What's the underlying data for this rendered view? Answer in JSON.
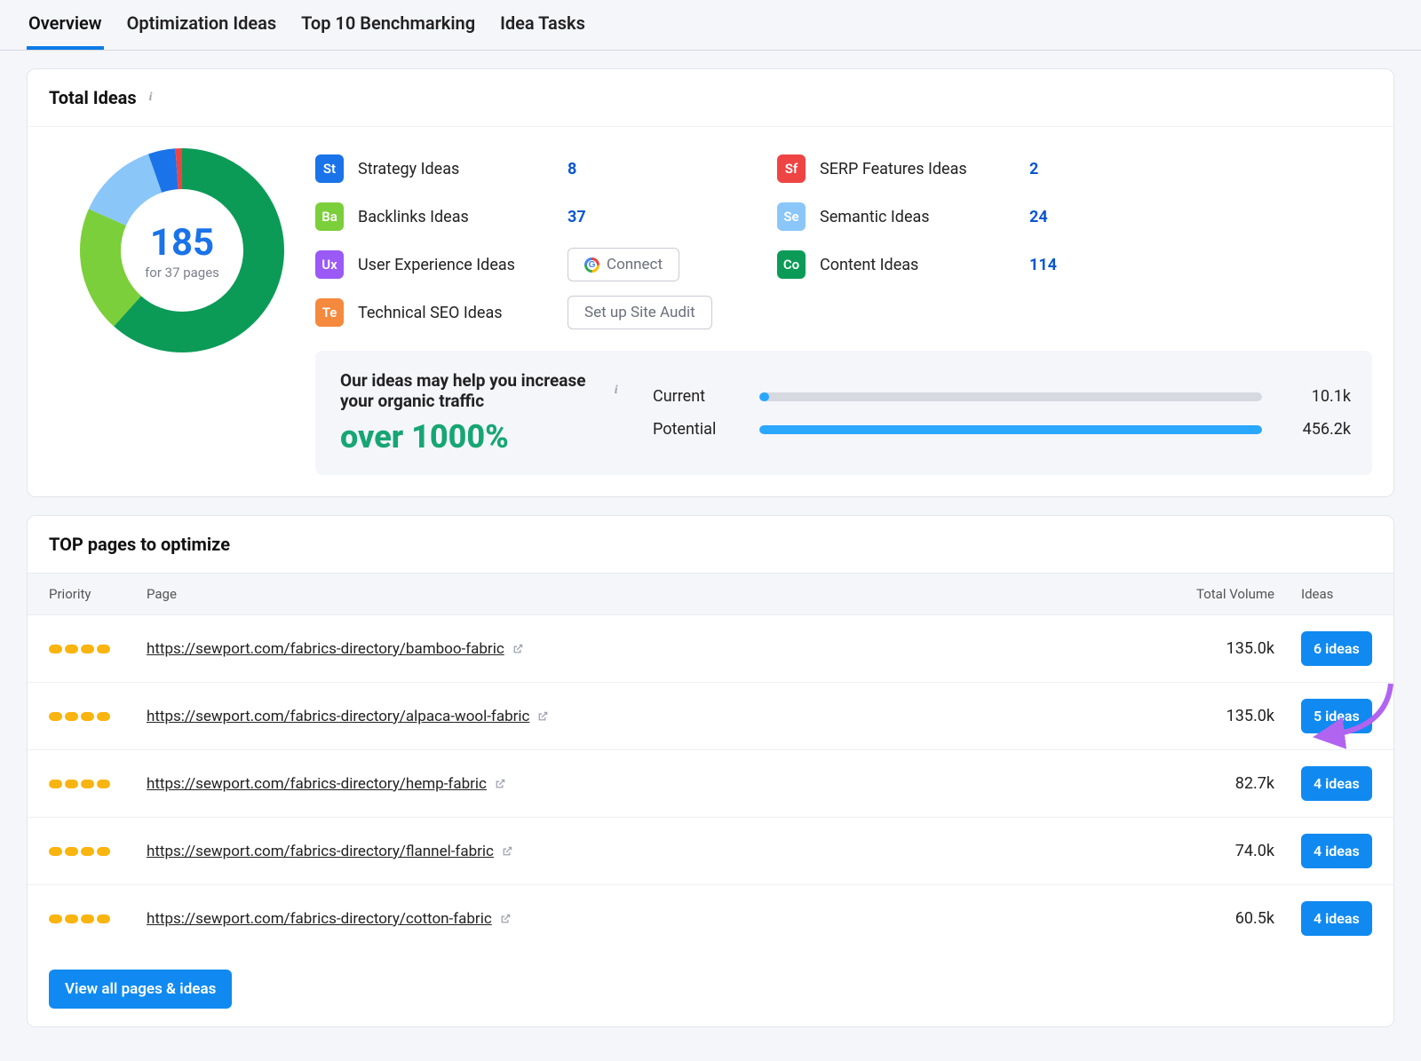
{
  "tabs": [
    {
      "label": "Overview",
      "active": true
    },
    {
      "label": "Optimization Ideas",
      "active": false
    },
    {
      "label": "Top 10 Benchmarking",
      "active": false
    },
    {
      "label": "Idea Tasks",
      "active": false
    }
  ],
  "totalIdeas": {
    "title": "Total Ideas",
    "count": "185",
    "sub": "for 37 pages",
    "categories": [
      {
        "chip": "St",
        "label": "Strategy Ideas",
        "value": "8",
        "color": "#1a73e8"
      },
      {
        "chip": "Ba",
        "label": "Backlinks Ideas",
        "value": "37",
        "color": "#7bcf3a"
      },
      {
        "chip": "Ux",
        "label": "User Experience Ideas",
        "button": "Connect",
        "btnKind": "google",
        "color": "#9b59f6"
      },
      {
        "chip": "Te",
        "label": "Technical SEO Ideas",
        "button": "Set up Site Audit",
        "color": "#f5893d"
      },
      {
        "chip": "Sf",
        "label": "SERP Features Ideas",
        "value": "2",
        "color": "#ef4444"
      },
      {
        "chip": "Se",
        "label": "Semantic Ideas",
        "value": "24",
        "color": "#8ac6f8"
      },
      {
        "chip": "Co",
        "label": "Content Ideas",
        "value": "114",
        "color": "#0b9b57"
      }
    ],
    "banner": {
      "title": "Our ideas may help you increase your organic traffic",
      "big": "over 1000%",
      "rows": [
        {
          "label": "Current",
          "value": "10.1k",
          "pct": 2
        },
        {
          "label": "Potential",
          "value": "456.2k",
          "pct": 100
        }
      ]
    }
  },
  "chart_data": {
    "type": "pie",
    "title": "Total Ideas",
    "series": [
      {
        "name": "Content Ideas",
        "value": 114,
        "color": "#0b9b57"
      },
      {
        "name": "Backlinks Ideas",
        "value": 37,
        "color": "#7bcf3a"
      },
      {
        "name": "Semantic Ideas",
        "value": 24,
        "color": "#8ac6f8"
      },
      {
        "name": "Strategy Ideas",
        "value": 8,
        "color": "#1a73e8"
      },
      {
        "name": "SERP Features Ideas",
        "value": 2,
        "color": "#ef4444"
      }
    ],
    "total": 185
  },
  "topPages": {
    "title": "TOP pages to optimize",
    "header": {
      "priority": "Priority",
      "page": "Page",
      "volume": "Total Volume",
      "ideas": "Ideas"
    },
    "rows": [
      {
        "url": "https://sewport.com/fabrics-directory/bamboo-fabric",
        "volume": "135.0k",
        "ideas": "6 ideas",
        "priority": 4
      },
      {
        "url": "https://sewport.com/fabrics-directory/alpaca-wool-fabric",
        "volume": "135.0k",
        "ideas": "5 ideas",
        "priority": 4
      },
      {
        "url": "https://sewport.com/fabrics-directory/hemp-fabric",
        "volume": "82.7k",
        "ideas": "4 ideas",
        "priority": 4
      },
      {
        "url": "https://sewport.com/fabrics-directory/flannel-fabric",
        "volume": "74.0k",
        "ideas": "4 ideas",
        "priority": 4
      },
      {
        "url": "https://sewport.com/fabrics-directory/cotton-fabric",
        "volume": "60.5k",
        "ideas": "4 ideas",
        "priority": 4
      }
    ],
    "viewAll": "View all pages & ideas"
  }
}
